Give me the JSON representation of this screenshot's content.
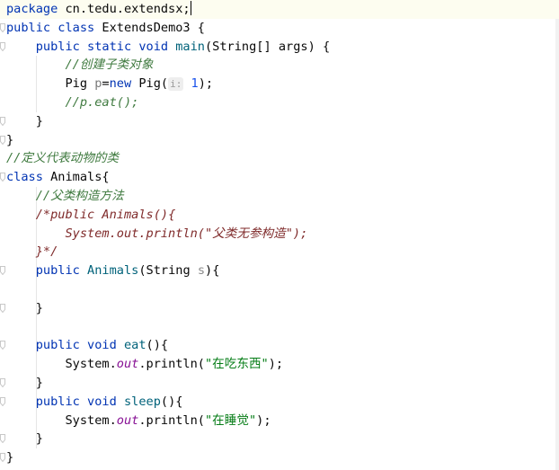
{
  "editor": {
    "lines": [
      {
        "parts": [
          {
            "t": "package ",
            "c": "kw"
          },
          {
            "t": "cn.tedu.extendsx;",
            "c": "pl"
          }
        ],
        "caret": true
      },
      {
        "parts": [
          {
            "t": "public class ",
            "c": "kw"
          },
          {
            "t": "ExtendsDemo3 {",
            "c": "pl"
          }
        ]
      },
      {
        "parts": [
          {
            "t": "    ",
            "c": "pl"
          },
          {
            "t": "public static void ",
            "c": "kw"
          },
          {
            "t": "main",
            "c": "mth"
          },
          {
            "t": "(String[] args) {",
            "c": "pl"
          }
        ]
      },
      {
        "parts": [
          {
            "t": "        ",
            "c": "pl"
          },
          {
            "t": "//创建子类对象",
            "c": "cmg"
          }
        ]
      },
      {
        "parts": [
          {
            "t": "        Pig ",
            "c": "pl"
          },
          {
            "t": "p",
            "c": "var"
          },
          {
            "t": "=",
            "c": "pl"
          },
          {
            "t": "new ",
            "c": "kw"
          },
          {
            "t": "Pig(",
            "c": "pl"
          },
          {
            "t": "i:",
            "c": "hint"
          },
          {
            "t": " 1",
            "c": "num"
          },
          {
            "t": ");",
            "c": "pl"
          }
        ]
      },
      {
        "parts": [
          {
            "t": "        ",
            "c": "pl"
          },
          {
            "t": "//p.eat();",
            "c": "cmg"
          }
        ]
      },
      {
        "parts": [
          {
            "t": "    }",
            "c": "pl"
          }
        ]
      },
      {
        "parts": [
          {
            "t": "}",
            "c": "pl"
          }
        ]
      },
      {
        "parts": [
          {
            "t": "//定义代表动物的类",
            "c": "cmg"
          }
        ]
      },
      {
        "parts": [
          {
            "t": "class ",
            "c": "kw"
          },
          {
            "t": "Animals{",
            "c": "pl"
          }
        ]
      },
      {
        "parts": [
          {
            "t": "    ",
            "c": "pl"
          },
          {
            "t": "//父类构造方法",
            "c": "cmg"
          }
        ]
      },
      {
        "parts": [
          {
            "t": "    ",
            "c": "pl"
          },
          {
            "t": "/*public Animals(){",
            "c": "cmr"
          }
        ]
      },
      {
        "parts": [
          {
            "t": "        ",
            "c": "pl"
          },
          {
            "t": "System.out.println(\"父类无参构造\");",
            "c": "cmr"
          }
        ]
      },
      {
        "parts": [
          {
            "t": "    ",
            "c": "pl"
          },
          {
            "t": "}*/",
            "c": "cmr"
          }
        ]
      },
      {
        "parts": [
          {
            "t": "    ",
            "c": "pl"
          },
          {
            "t": "public ",
            "c": "kw"
          },
          {
            "t": "Animals",
            "c": "mth"
          },
          {
            "t": "(String ",
            "c": "pl"
          },
          {
            "t": "s",
            "c": "prm"
          },
          {
            "t": "){",
            "c": "pl"
          }
        ]
      },
      {
        "parts": []
      },
      {
        "parts": [
          {
            "t": "    }",
            "c": "pl"
          }
        ]
      },
      {
        "parts": []
      },
      {
        "parts": [
          {
            "t": "    ",
            "c": "pl"
          },
          {
            "t": "public void ",
            "c": "kw"
          },
          {
            "t": "eat",
            "c": "mth"
          },
          {
            "t": "(){",
            "c": "pl"
          }
        ]
      },
      {
        "parts": [
          {
            "t": "        System.",
            "c": "pl"
          },
          {
            "t": "out",
            "c": "fld"
          },
          {
            "t": ".println(",
            "c": "pl"
          },
          {
            "t": "\"在吃东西\"",
            "c": "str"
          },
          {
            "t": ");",
            "c": "pl"
          }
        ]
      },
      {
        "parts": [
          {
            "t": "    }",
            "c": "pl"
          }
        ]
      },
      {
        "parts": [
          {
            "t": "    ",
            "c": "pl"
          },
          {
            "t": "public void ",
            "c": "kw"
          },
          {
            "t": "sleep",
            "c": "mth"
          },
          {
            "t": "(){",
            "c": "pl"
          }
        ]
      },
      {
        "parts": [
          {
            "t": "        System.",
            "c": "pl"
          },
          {
            "t": "out",
            "c": "fld"
          },
          {
            "t": ".println(",
            "c": "pl"
          },
          {
            "t": "\"在睡觉\"",
            "c": "str"
          },
          {
            "t": ");",
            "c": "pl"
          }
        ]
      },
      {
        "parts": [
          {
            "t": "    }",
            "c": "pl"
          }
        ]
      },
      {
        "parts": [
          {
            "t": "}",
            "c": "pl"
          }
        ]
      }
    ],
    "colors": {
      "keyword": "#0033b3",
      "comment": "#3f7a3f",
      "block_comment": "#7f2a2a",
      "string": "#067d17",
      "static_field": "#871094",
      "method": "#00627a",
      "background": "#ffffff",
      "current_line": "#fdfdf0"
    }
  }
}
